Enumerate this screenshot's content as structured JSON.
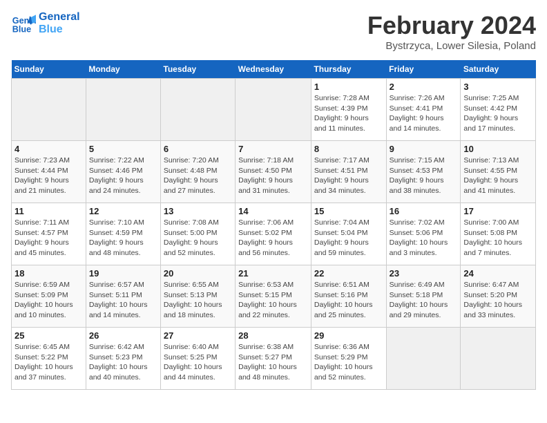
{
  "header": {
    "logo_line1": "General",
    "logo_line2": "Blue",
    "month": "February 2024",
    "location": "Bystrzyca, Lower Silesia, Poland"
  },
  "weekdays": [
    "Sunday",
    "Monday",
    "Tuesday",
    "Wednesday",
    "Thursday",
    "Friday",
    "Saturday"
  ],
  "weeks": [
    [
      {
        "day": "",
        "info": ""
      },
      {
        "day": "",
        "info": ""
      },
      {
        "day": "",
        "info": ""
      },
      {
        "day": "",
        "info": ""
      },
      {
        "day": "1",
        "info": "Sunrise: 7:28 AM\nSunset: 4:39 PM\nDaylight: 9 hours\nand 11 minutes."
      },
      {
        "day": "2",
        "info": "Sunrise: 7:26 AM\nSunset: 4:41 PM\nDaylight: 9 hours\nand 14 minutes."
      },
      {
        "day": "3",
        "info": "Sunrise: 7:25 AM\nSunset: 4:42 PM\nDaylight: 9 hours\nand 17 minutes."
      }
    ],
    [
      {
        "day": "4",
        "info": "Sunrise: 7:23 AM\nSunset: 4:44 PM\nDaylight: 9 hours\nand 21 minutes."
      },
      {
        "day": "5",
        "info": "Sunrise: 7:22 AM\nSunset: 4:46 PM\nDaylight: 9 hours\nand 24 minutes."
      },
      {
        "day": "6",
        "info": "Sunrise: 7:20 AM\nSunset: 4:48 PM\nDaylight: 9 hours\nand 27 minutes."
      },
      {
        "day": "7",
        "info": "Sunrise: 7:18 AM\nSunset: 4:50 PM\nDaylight: 9 hours\nand 31 minutes."
      },
      {
        "day": "8",
        "info": "Sunrise: 7:17 AM\nSunset: 4:51 PM\nDaylight: 9 hours\nand 34 minutes."
      },
      {
        "day": "9",
        "info": "Sunrise: 7:15 AM\nSunset: 4:53 PM\nDaylight: 9 hours\nand 38 minutes."
      },
      {
        "day": "10",
        "info": "Sunrise: 7:13 AM\nSunset: 4:55 PM\nDaylight: 9 hours\nand 41 minutes."
      }
    ],
    [
      {
        "day": "11",
        "info": "Sunrise: 7:11 AM\nSunset: 4:57 PM\nDaylight: 9 hours\nand 45 minutes."
      },
      {
        "day": "12",
        "info": "Sunrise: 7:10 AM\nSunset: 4:59 PM\nDaylight: 9 hours\nand 48 minutes."
      },
      {
        "day": "13",
        "info": "Sunrise: 7:08 AM\nSunset: 5:00 PM\nDaylight: 9 hours\nand 52 minutes."
      },
      {
        "day": "14",
        "info": "Sunrise: 7:06 AM\nSunset: 5:02 PM\nDaylight: 9 hours\nand 56 minutes."
      },
      {
        "day": "15",
        "info": "Sunrise: 7:04 AM\nSunset: 5:04 PM\nDaylight: 9 hours\nand 59 minutes."
      },
      {
        "day": "16",
        "info": "Sunrise: 7:02 AM\nSunset: 5:06 PM\nDaylight: 10 hours\nand 3 minutes."
      },
      {
        "day": "17",
        "info": "Sunrise: 7:00 AM\nSunset: 5:08 PM\nDaylight: 10 hours\nand 7 minutes."
      }
    ],
    [
      {
        "day": "18",
        "info": "Sunrise: 6:59 AM\nSunset: 5:09 PM\nDaylight: 10 hours\nand 10 minutes."
      },
      {
        "day": "19",
        "info": "Sunrise: 6:57 AM\nSunset: 5:11 PM\nDaylight: 10 hours\nand 14 minutes."
      },
      {
        "day": "20",
        "info": "Sunrise: 6:55 AM\nSunset: 5:13 PM\nDaylight: 10 hours\nand 18 minutes."
      },
      {
        "day": "21",
        "info": "Sunrise: 6:53 AM\nSunset: 5:15 PM\nDaylight: 10 hours\nand 22 minutes."
      },
      {
        "day": "22",
        "info": "Sunrise: 6:51 AM\nSunset: 5:16 PM\nDaylight: 10 hours\nand 25 minutes."
      },
      {
        "day": "23",
        "info": "Sunrise: 6:49 AM\nSunset: 5:18 PM\nDaylight: 10 hours\nand 29 minutes."
      },
      {
        "day": "24",
        "info": "Sunrise: 6:47 AM\nSunset: 5:20 PM\nDaylight: 10 hours\nand 33 minutes."
      }
    ],
    [
      {
        "day": "25",
        "info": "Sunrise: 6:45 AM\nSunset: 5:22 PM\nDaylight: 10 hours\nand 37 minutes."
      },
      {
        "day": "26",
        "info": "Sunrise: 6:42 AM\nSunset: 5:23 PM\nDaylight: 10 hours\nand 40 minutes."
      },
      {
        "day": "27",
        "info": "Sunrise: 6:40 AM\nSunset: 5:25 PM\nDaylight: 10 hours\nand 44 minutes."
      },
      {
        "day": "28",
        "info": "Sunrise: 6:38 AM\nSunset: 5:27 PM\nDaylight: 10 hours\nand 48 minutes."
      },
      {
        "day": "29",
        "info": "Sunrise: 6:36 AM\nSunset: 5:29 PM\nDaylight: 10 hours\nand 52 minutes."
      },
      {
        "day": "",
        "info": ""
      },
      {
        "day": "",
        "info": ""
      }
    ]
  ]
}
